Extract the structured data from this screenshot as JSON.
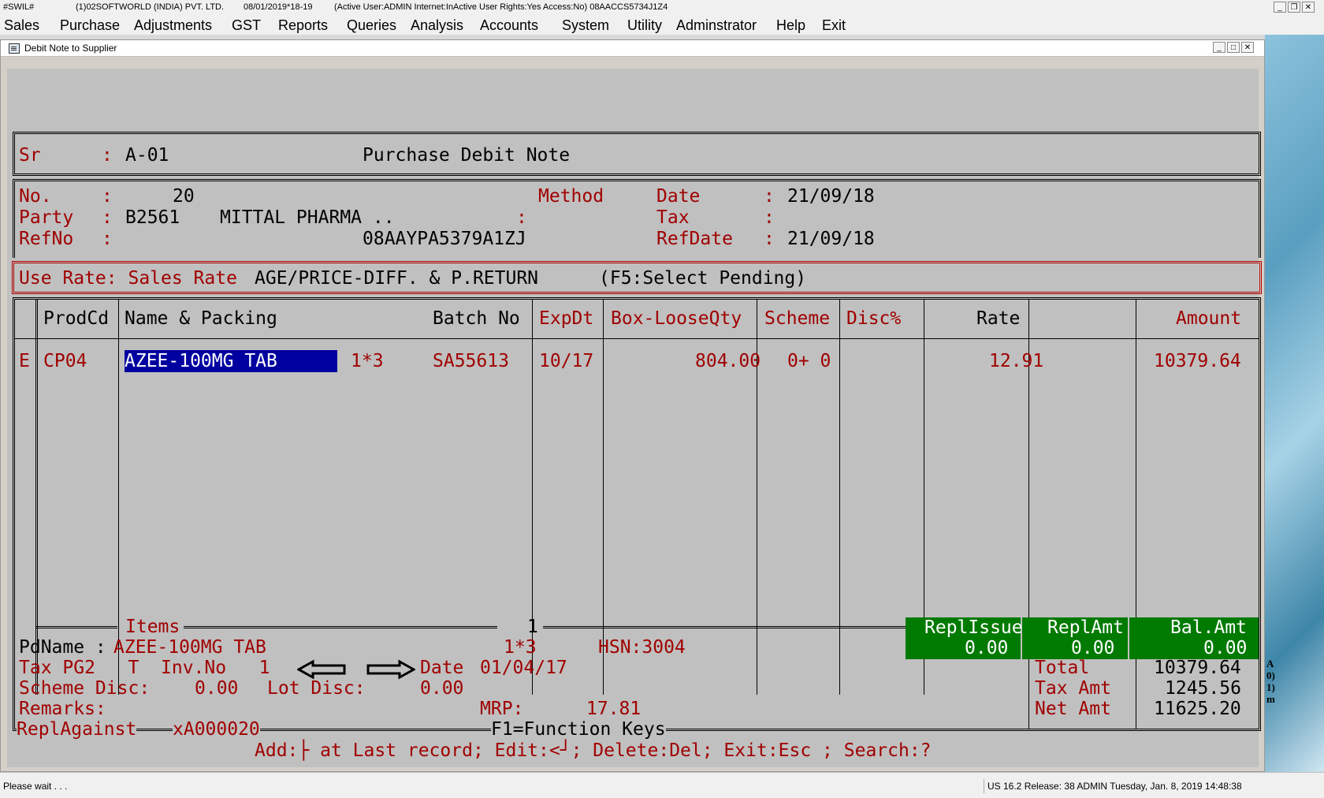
{
  "titlebar": {
    "app": "#SWIL#",
    "company": "(1)02SOFTWORLD (INDIA) PVT. LTD.",
    "date": "08/01/2019*18-19",
    "status": "(Active User:ADMIN Internet:InActive User Rights:Yes Access:No) 08AACCS5734J1Z4"
  },
  "menu": {
    "items": [
      "Sales",
      "Purchase",
      "Adjustments",
      "GST",
      "Reports",
      "Queries",
      "Analysis",
      "Accounts",
      "System",
      "Utility",
      "Adminstrator",
      "Help",
      "Exit"
    ]
  },
  "window": {
    "title": "Debit Note to Supplier"
  },
  "header": {
    "sr_label": "Sr",
    "sr_value": "A-01",
    "doc_title": "Purchase Debit Note",
    "no_label": "No.",
    "no_value": "20",
    "method_label": "Method",
    "date_label": "Date",
    "date_value": "21/09/18",
    "party_label": "Party",
    "party_code": "B2561",
    "party_name": "MITTAL PHARMA ..",
    "tax_label": "Tax",
    "refno_label": "RefNo",
    "gstin": "08AAYPA5379A1ZJ",
    "refdate_label": "RefDate",
    "refdate_value": "21/09/18",
    "colon": ":"
  },
  "rate_bar": {
    "label": "Use Rate: Sales Rate",
    "mode": "AGE/PRICE-DIFF. & P.RETURN",
    "hint": "(F5:Select Pending)"
  },
  "table": {
    "columns": [
      "ProdCd",
      "Name & Packing",
      "Batch No",
      "ExpDt",
      "Box-LooseQty",
      "Scheme",
      "Disc%",
      "Rate",
      "Amount"
    ],
    "rows": [
      {
        "flag": "E",
        "prodcd": "CP04",
        "name": "AZEE-100MG TAB",
        "packing": "1*3",
        "batch": "SA55613",
        "expdt": "10/17",
        "qty": "804.00",
        "scheme": "0+ 0",
        "disc": "",
        "rate": "12.91",
        "amount": "10379.64"
      }
    ]
  },
  "footer": {
    "items_label": "Items",
    "items_count": "1",
    "pdname_label": "PdName :",
    "pdname": "AZEE-100MG TAB",
    "packing": "1*3",
    "hsn": "HSN:3004",
    "tax_line": "Tax PG2   T  Inv.No   1",
    "date_label": "Date",
    "date_value": "01/04/17",
    "scheme_disc_label": "Scheme Disc:",
    "scheme_disc": "0.00",
    "lot_disc_label": "Lot Disc:",
    "lot_disc": "0.00",
    "remarks_label": "Remarks:",
    "mrp_label": "MRP:",
    "mrp": "17.81",
    "repl_against_label": "ReplAgainst",
    "repl_against": "xA000020",
    "function_keys": "F1=Function Keys",
    "help_line": "Add:├ at Last record; Edit:<┘; Delete:Del; Exit:Esc ; Search:?"
  },
  "totals": {
    "repl_issue_label": "ReplIssue",
    "repl_issue": "0.00",
    "repl_amt_label": "ReplAmt",
    "repl_amt": "0.00",
    "bal_amt_label": "Bal.Amt",
    "bal_amt": "0.00",
    "total_label": "Total",
    "total": "10379.64",
    "tax_amt_label": "Tax Amt",
    "tax_amt": "1245.56",
    "net_amt_label": "Net Amt",
    "net_amt": "11625.20"
  },
  "desktop_text": [
    "A",
    "0)",
    "1)",
    "m"
  ],
  "statusbar": {
    "left": "Please wait . . .",
    "right": "US 16.2 Release: 38 ADMIN  Tuesday, Jan.  8, 2019  14:48:38"
  },
  "colors": {
    "console_bg": "#c0c0c0",
    "text_red": "#a00000",
    "selection": "#0000a0",
    "totals_green": "#007a00"
  }
}
